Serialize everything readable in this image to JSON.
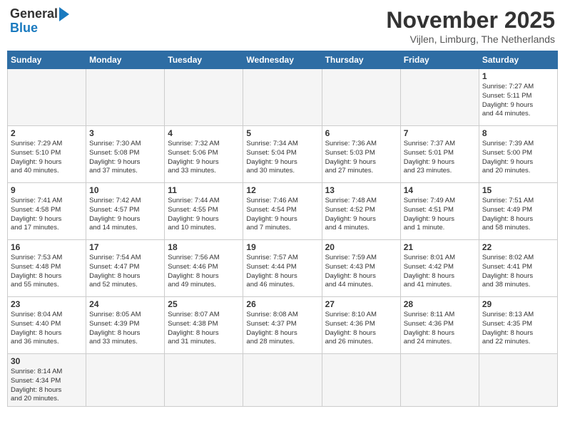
{
  "header": {
    "logo_general": "General",
    "logo_blue": "Blue",
    "month_title": "November 2025",
    "location": "Vijlen, Limburg, The Netherlands"
  },
  "days_of_week": [
    "Sunday",
    "Monday",
    "Tuesday",
    "Wednesday",
    "Thursday",
    "Friday",
    "Saturday"
  ],
  "weeks": [
    {
      "cells": [
        {
          "day": null,
          "info": null
        },
        {
          "day": null,
          "info": null
        },
        {
          "day": null,
          "info": null
        },
        {
          "day": null,
          "info": null
        },
        {
          "day": null,
          "info": null
        },
        {
          "day": null,
          "info": null
        },
        {
          "day": "1",
          "info": "Sunrise: 7:27 AM\nSunset: 5:11 PM\nDaylight: 9 hours\nand 44 minutes."
        }
      ]
    },
    {
      "cells": [
        {
          "day": "2",
          "info": "Sunrise: 7:29 AM\nSunset: 5:10 PM\nDaylight: 9 hours\nand 40 minutes."
        },
        {
          "day": "3",
          "info": "Sunrise: 7:30 AM\nSunset: 5:08 PM\nDaylight: 9 hours\nand 37 minutes."
        },
        {
          "day": "4",
          "info": "Sunrise: 7:32 AM\nSunset: 5:06 PM\nDaylight: 9 hours\nand 33 minutes."
        },
        {
          "day": "5",
          "info": "Sunrise: 7:34 AM\nSunset: 5:04 PM\nDaylight: 9 hours\nand 30 minutes."
        },
        {
          "day": "6",
          "info": "Sunrise: 7:36 AM\nSunset: 5:03 PM\nDaylight: 9 hours\nand 27 minutes."
        },
        {
          "day": "7",
          "info": "Sunrise: 7:37 AM\nSunset: 5:01 PM\nDaylight: 9 hours\nand 23 minutes."
        },
        {
          "day": "8",
          "info": "Sunrise: 7:39 AM\nSunset: 5:00 PM\nDaylight: 9 hours\nand 20 minutes."
        }
      ]
    },
    {
      "cells": [
        {
          "day": "9",
          "info": "Sunrise: 7:41 AM\nSunset: 4:58 PM\nDaylight: 9 hours\nand 17 minutes."
        },
        {
          "day": "10",
          "info": "Sunrise: 7:42 AM\nSunset: 4:57 PM\nDaylight: 9 hours\nand 14 minutes."
        },
        {
          "day": "11",
          "info": "Sunrise: 7:44 AM\nSunset: 4:55 PM\nDaylight: 9 hours\nand 10 minutes."
        },
        {
          "day": "12",
          "info": "Sunrise: 7:46 AM\nSunset: 4:54 PM\nDaylight: 9 hours\nand 7 minutes."
        },
        {
          "day": "13",
          "info": "Sunrise: 7:48 AM\nSunset: 4:52 PM\nDaylight: 9 hours\nand 4 minutes."
        },
        {
          "day": "14",
          "info": "Sunrise: 7:49 AM\nSunset: 4:51 PM\nDaylight: 9 hours\nand 1 minute."
        },
        {
          "day": "15",
          "info": "Sunrise: 7:51 AM\nSunset: 4:49 PM\nDaylight: 8 hours\nand 58 minutes."
        }
      ]
    },
    {
      "cells": [
        {
          "day": "16",
          "info": "Sunrise: 7:53 AM\nSunset: 4:48 PM\nDaylight: 8 hours\nand 55 minutes."
        },
        {
          "day": "17",
          "info": "Sunrise: 7:54 AM\nSunset: 4:47 PM\nDaylight: 8 hours\nand 52 minutes."
        },
        {
          "day": "18",
          "info": "Sunrise: 7:56 AM\nSunset: 4:46 PM\nDaylight: 8 hours\nand 49 minutes."
        },
        {
          "day": "19",
          "info": "Sunrise: 7:57 AM\nSunset: 4:44 PM\nDaylight: 8 hours\nand 46 minutes."
        },
        {
          "day": "20",
          "info": "Sunrise: 7:59 AM\nSunset: 4:43 PM\nDaylight: 8 hours\nand 44 minutes."
        },
        {
          "day": "21",
          "info": "Sunrise: 8:01 AM\nSunset: 4:42 PM\nDaylight: 8 hours\nand 41 minutes."
        },
        {
          "day": "22",
          "info": "Sunrise: 8:02 AM\nSunset: 4:41 PM\nDaylight: 8 hours\nand 38 minutes."
        }
      ]
    },
    {
      "cells": [
        {
          "day": "23",
          "info": "Sunrise: 8:04 AM\nSunset: 4:40 PM\nDaylight: 8 hours\nand 36 minutes."
        },
        {
          "day": "24",
          "info": "Sunrise: 8:05 AM\nSunset: 4:39 PM\nDaylight: 8 hours\nand 33 minutes."
        },
        {
          "day": "25",
          "info": "Sunrise: 8:07 AM\nSunset: 4:38 PM\nDaylight: 8 hours\nand 31 minutes."
        },
        {
          "day": "26",
          "info": "Sunrise: 8:08 AM\nSunset: 4:37 PM\nDaylight: 8 hours\nand 28 minutes."
        },
        {
          "day": "27",
          "info": "Sunrise: 8:10 AM\nSunset: 4:36 PM\nDaylight: 8 hours\nand 26 minutes."
        },
        {
          "day": "28",
          "info": "Sunrise: 8:11 AM\nSunset: 4:36 PM\nDaylight: 8 hours\nand 24 minutes."
        },
        {
          "day": "29",
          "info": "Sunrise: 8:13 AM\nSunset: 4:35 PM\nDaylight: 8 hours\nand 22 minutes."
        }
      ]
    },
    {
      "cells": [
        {
          "day": "30",
          "info": "Sunrise: 8:14 AM\nSunset: 4:34 PM\nDaylight: 8 hours\nand 20 minutes."
        },
        {
          "day": null,
          "info": null
        },
        {
          "day": null,
          "info": null
        },
        {
          "day": null,
          "info": null
        },
        {
          "day": null,
          "info": null
        },
        {
          "day": null,
          "info": null
        },
        {
          "day": null,
          "info": null
        }
      ]
    }
  ]
}
